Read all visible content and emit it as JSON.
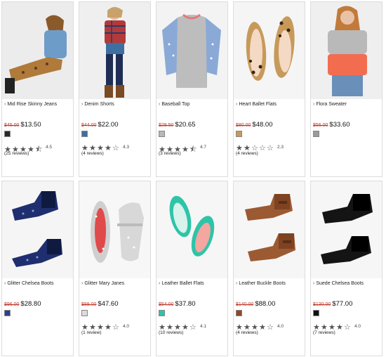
{
  "products": [
    {
      "name": "Mid Rise Skinny Jeans",
      "was": "$45.00",
      "price": "$13.50",
      "swatch": "#2a2a2a",
      "rating_value": 4.5,
      "rating": "4.5",
      "reviews": "(25 reviews)"
    },
    {
      "name": "Denim Shorts",
      "was": "$44.00",
      "price": "$22.00",
      "swatch": "#3d6fa0",
      "rating_value": 4.3,
      "rating": "4.3",
      "reviews": "(4 reviews)"
    },
    {
      "name": "Baseball Top",
      "was": "$29.50",
      "price": "$20.65",
      "swatch": "#b8b8b8",
      "rating_value": 4.7,
      "rating": "4.7",
      "reviews": "(3 reviews)"
    },
    {
      "name": "Heart Ballet Flats",
      "was": "$80.00",
      "price": "$48.00",
      "swatch": "#c79a5a",
      "rating_value": 2.3,
      "rating": "2.3",
      "reviews": "(4 reviews)"
    },
    {
      "name": "Flora Sweater",
      "was": "$56.00",
      "price": "$33.60",
      "swatch": "#9a9a9a",
      "rating_value": null,
      "rating": "",
      "reviews": ""
    },
    {
      "name": "Glitter Chelsea Boots",
      "was": "$96.00",
      "price": "$28.80",
      "swatch": "#2b3f8c",
      "rating_value": null,
      "rating": "",
      "reviews": ""
    },
    {
      "name": "Glitter Mary Janes",
      "was": "$88.00",
      "price": "$47.60",
      "swatch": "#dcdcdc",
      "rating_value": 4.0,
      "rating": "4.0",
      "reviews": "(1 review)"
    },
    {
      "name": "Leather Ballet Flats",
      "was": "$54.00",
      "price": "$37.80",
      "swatch": "#2ec4a8",
      "rating_value": 4.1,
      "rating": "4.1",
      "reviews": "(10 reviews)"
    },
    {
      "name": "Leather Buckle Boots",
      "was": "$140.00",
      "price": "$88.00",
      "swatch": "#8b4a2a",
      "rating_value": 4.0,
      "rating": "4.0",
      "reviews": "(4 reviews)"
    },
    {
      "name": "Suede Chelsea Boots",
      "was": "$130.00",
      "price": "$77.00",
      "swatch": "#111111",
      "rating_value": 4.0,
      "rating": "4.0",
      "reviews": "(7 reviews)"
    }
  ],
  "chevron": "›"
}
